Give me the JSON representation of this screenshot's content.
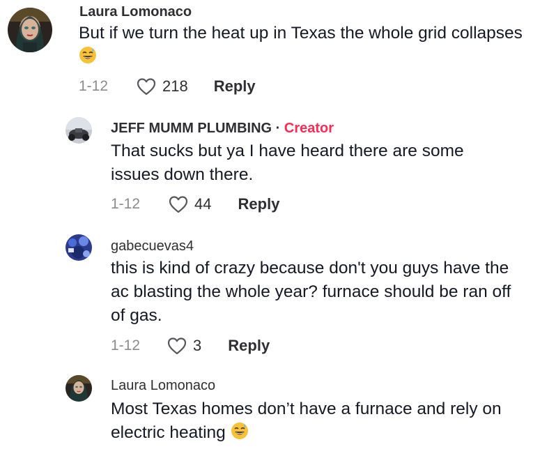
{
  "comments": [
    {
      "username": "Laura Lomonaco",
      "avatar_icon": "avatar-laura",
      "text": "But if we turn the heat up in Texas the whole grid collapses",
      "emoji": "grinning-sweat-emoji",
      "date": "1-12",
      "likes": "218",
      "reply_label": "Reply"
    }
  ],
  "replies": [
    {
      "username": "JEFF MUMM PLUMBING",
      "separator": "·",
      "badge": "Creator",
      "avatar_icon": "avatar-jeff",
      "text": "That sucks but ya I have heard there are some issues down there.",
      "date": "1-12",
      "likes": "44",
      "reply_label": "Reply"
    },
    {
      "username": "gabecuevas4",
      "avatar_icon": "avatar-gabe",
      "text": "this is kind of crazy because don't you guys have the ac blasting the whole year? furnace should be ran off of gas.",
      "date": "1-12",
      "likes": "3",
      "reply_label": "Reply"
    },
    {
      "username": "Laura Lomonaco",
      "avatar_icon": "avatar-laura",
      "text": "Most Texas homes don’t have a furnace and rely on electric heating",
      "emoji": "grinning-sweat-emoji",
      "date": "",
      "likes": "",
      "reply_label": ""
    }
  ],
  "colors": {
    "creator_badge": "#fe2c55",
    "meta_gray": "#8a8b91",
    "text": "#161823"
  }
}
